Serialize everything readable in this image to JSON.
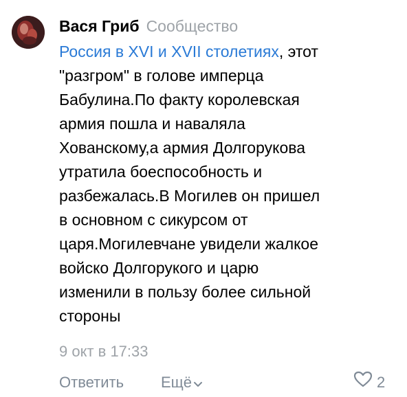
{
  "comment": {
    "author": "Вася Гриб",
    "source": "Сообщество",
    "link_text": "Россия в XVI и XVII столетиях",
    "lines": [
      ", этот",
      "\"разгром\" в голове имперца",
      "Бабулина.По факту королевская",
      "армия пошла и наваляла",
      "Хованскому,а армия Долгорукова",
      "утратила боеспособность и",
      "разбежалась.В Могилев он пришел",
      "в основном с сикурсом от",
      "царя.Могилевчане увидели жалкое",
      "войско Долгорукого и царю",
      "изменили в пользу более сильной",
      "стороны"
    ],
    "date": "9 окт в 17:33"
  },
  "actions": {
    "reply_label": "Ответить",
    "more_label": "Ещё",
    "like_count": "2"
  },
  "colors": {
    "link": "#2a7ad6",
    "muted": "#9ea3a8",
    "action": "#7f8a96"
  },
  "icons": {
    "avatar": "avatar-image",
    "more": "chevron-down-icon",
    "like": "heart-icon"
  }
}
